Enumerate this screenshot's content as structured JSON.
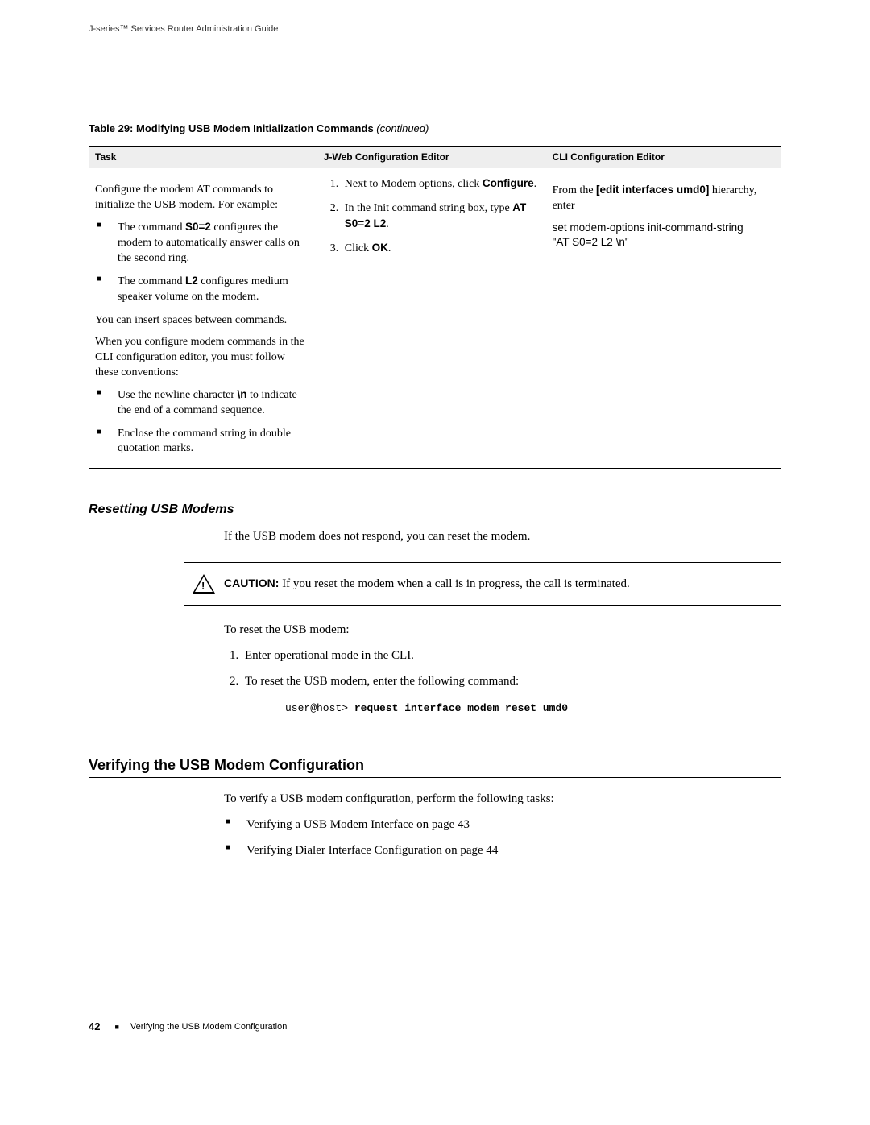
{
  "running_head": "J-series™ Services Router Administration Guide",
  "table": {
    "title_prefix": "Table 29: Modifying USB Modem Initialization Commands",
    "title_suffix": " (continued)",
    "headers": {
      "task": "Task",
      "jweb": "J-Web Configuration Editor",
      "cli": "CLI Configuration Editor"
    },
    "task": {
      "intro": "Configure the modem AT commands to initialize the USB modem. For example:",
      "b1_pre": "The command ",
      "b1_cmd": "S0=2",
      "b1_post": " configures the modem to automatically answer calls on the second ring.",
      "b2_pre": "The command ",
      "b2_cmd": "L2",
      "b2_post": " configures medium speaker volume on the modem.",
      "p2": "You can insert spaces between commands.",
      "p3": "When you configure modem commands in the CLI configuration editor, you must follow these conventions:",
      "c1_pre": "Use the newline character ",
      "c1_cmd": "\\n",
      "c1_post": " to indicate the end of a command sequence.",
      "c2": "Enclose the command string in double quotation marks."
    },
    "jweb": {
      "s1_pre": "Next to Modem options, click ",
      "s1_b": "Configure",
      "s2_pre": "In the Init command string box, type ",
      "s2_b": "AT S0=2 L2",
      "s3_pre": "Click ",
      "s3_b": "OK"
    },
    "cli": {
      "l1_pre": "From the ",
      "l1_b": "[edit interfaces umd0]",
      "l1_post": " hierarchy, enter",
      "l2a": "set modem-options init-command-string",
      "l2b": "\"AT S0=2 L2 \\n\""
    }
  },
  "reset": {
    "heading": "Resetting USB Modems",
    "intro": "If the USB modem does not respond, you can reset the modem.",
    "caution_label": "CAUTION:",
    "caution_text": " If you reset the modem when a call is in progress, the call is terminated.",
    "lead": "To reset the USB modem:",
    "s1": "Enter operational mode in the CLI.",
    "s2": "To reset the USB modem, enter the following command:",
    "prompt": "user@host> ",
    "cmd": "request interface modem reset umd0"
  },
  "verify": {
    "heading": "Verifying the USB Modem Configuration",
    "intro": "To verify a USB modem configuration, perform the following tasks:",
    "i1": "Verifying a USB Modem Interface on page 43",
    "i2": "Verifying Dialer Interface Configuration on page 44"
  },
  "footer": {
    "page": "42",
    "crumb": "Verifying the USB Modem Configuration"
  }
}
